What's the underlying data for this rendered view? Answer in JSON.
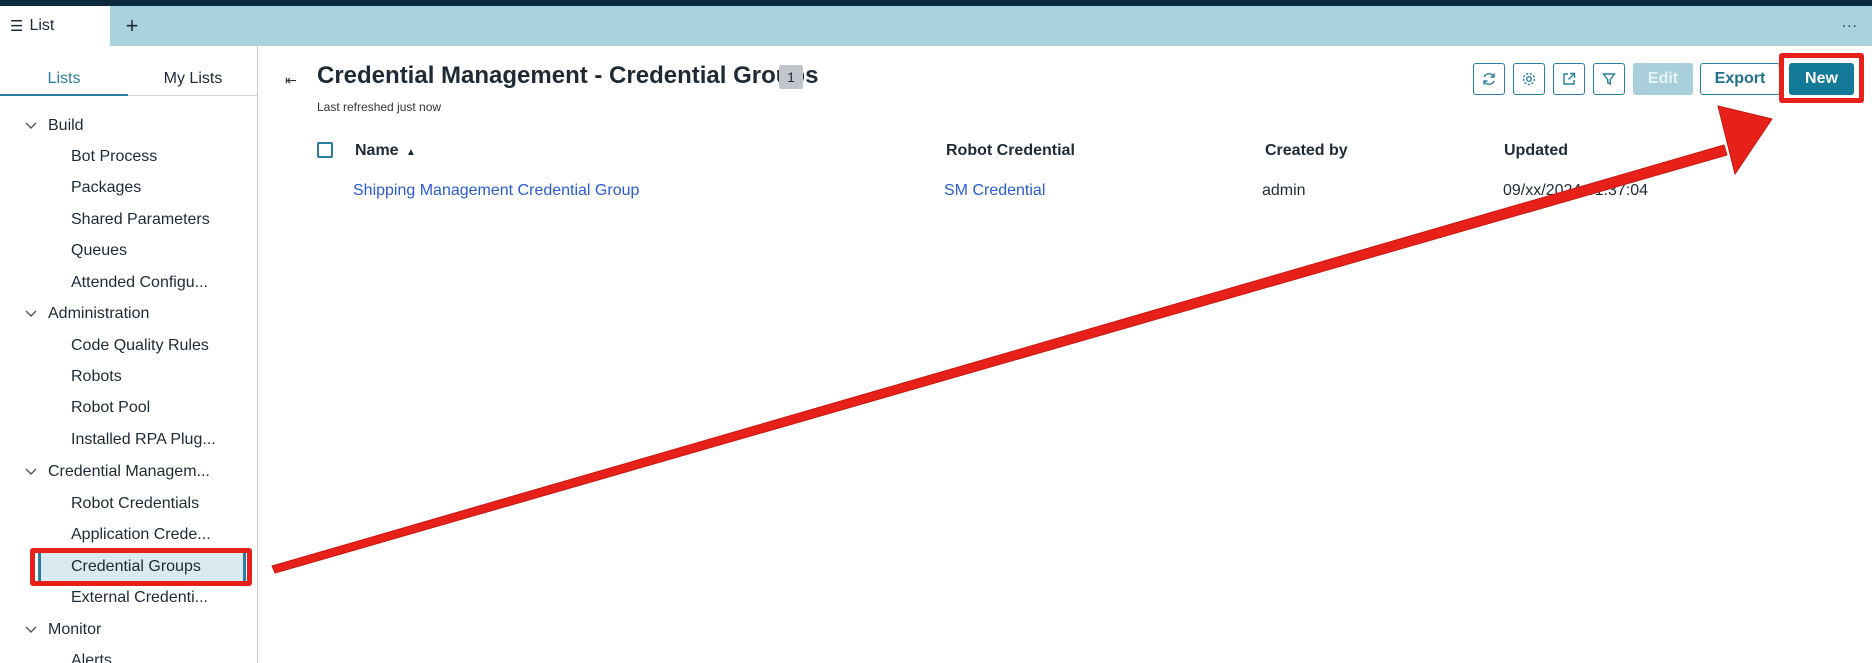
{
  "tab": {
    "icon": "hamburger-icon",
    "label": "List",
    "add": "+",
    "overflow": "..."
  },
  "sidebar": {
    "tabs": [
      "Lists",
      "My Lists"
    ],
    "sections": [
      {
        "label": "Build",
        "items": [
          "Bot Process",
          "Packages",
          "Shared Parameters",
          "Queues",
          "Attended Configu..."
        ]
      },
      {
        "label": "Administration",
        "items": [
          "Code Quality Rules",
          "Robots",
          "Robot Pool",
          "Installed RPA Plug..."
        ]
      },
      {
        "label": "Credential Managem...",
        "items": [
          "Robot Credentials",
          "Application Crede...",
          "Credential Groups",
          "External Credenti..."
        ]
      },
      {
        "label": "Monitor",
        "items": [
          "Alerts"
        ]
      }
    ],
    "selected_item": "Credential Groups"
  },
  "main": {
    "title": "Credential Management - Credential Groups",
    "count": "1",
    "last_refreshed": "Last refreshed just now",
    "toolbar": {
      "icons": [
        "refresh-icon",
        "settings-icon",
        "share-icon",
        "filter-icon"
      ],
      "edit": "Edit",
      "export": "Export",
      "new": "New"
    },
    "table": {
      "columns": [
        "Name",
        "Robot Credential",
        "Created by",
        "Updated"
      ],
      "sort_indicator": "▲",
      "rows": [
        {
          "name": "Shipping Management Credential Group",
          "robot_credential": "SM Credential",
          "created_by": "admin",
          "updated": "09/xx/2024 01:37:04"
        }
      ]
    }
  },
  "annotation": {
    "color": "#e8201a"
  }
}
